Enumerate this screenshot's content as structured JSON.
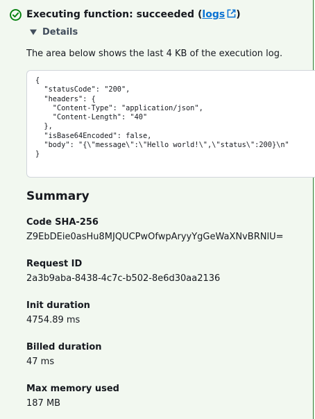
{
  "status": {
    "text": "Executing function: succeeded",
    "open_paren": "(",
    "link_label": "logs",
    "close_paren": ")",
    "color": "#037f0c",
    "icon": "check-circle-icon"
  },
  "details": {
    "label": "Details",
    "icon": "caret-down-icon"
  },
  "description": "The area below shows the last 4 KB of the execution log.",
  "log_output": "{\n  \"statusCode\": \"200\",\n  \"headers\": {\n    \"Content-Type\": \"application/json\",\n    \"Content-Length\": \"40\"\n  },\n  \"isBase64Encoded\": false,\n  \"body\": \"{\\\"message\\\":\\\"Hello world!\\\",\\\"status\\\":200}\\n\"\n}",
  "summary": {
    "title": "Summary",
    "fields": [
      {
        "label": "Code SHA-256",
        "value": "Z9EbDEie0asHu8MJQUCPwOfwpAryyYgGeWaXNvBRNlU="
      },
      {
        "label": "Request ID",
        "value": "2a3b9aba-8438-4c7c-b502-8e6d30aa2136"
      },
      {
        "label": "Init duration",
        "value": "4754.89 ms"
      },
      {
        "label": "Billed duration",
        "value": "47 ms"
      },
      {
        "label": "Max memory used",
        "value": "187 MB"
      }
    ]
  }
}
